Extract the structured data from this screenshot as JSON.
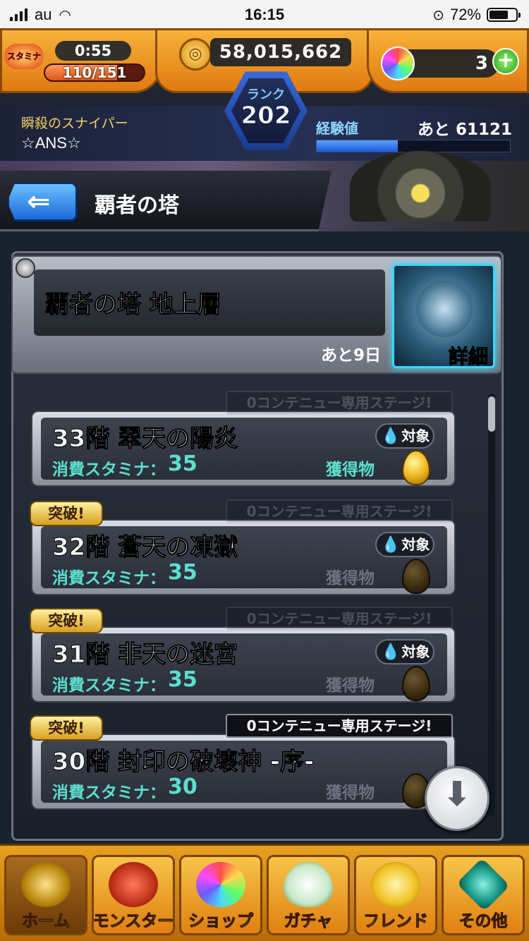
{
  "status_bar": {
    "carrier": "au",
    "time": "16:15",
    "battery": "72%",
    "battery_level": 0.72
  },
  "hud": {
    "stamina_label": "スタミナ",
    "stamina_timer": "0:55",
    "stamina": "110/151",
    "stamina_level": 0.73,
    "gold": "58,015,662",
    "orbs": "3",
    "add_label": "+",
    "rank_label": "ランク",
    "rank": "202",
    "exp_label": "経験値",
    "exp_remaining": "あと 61121",
    "exp_level": 0.42
  },
  "player": {
    "title": "瞬殺のスナイパー",
    "name": "☆ANS☆"
  },
  "header": {
    "back_arrow": "⇐",
    "title": "覇者の塔"
  },
  "dungeon": {
    "name": "覇者の塔 地上層",
    "days_left": "あと9日",
    "detail_label": "詳細"
  },
  "stage_common": {
    "stamina_label": "消費スタミナ：",
    "reward_label": "獲得物",
    "target_label": "対象",
    "breakthrough_label": "突破!",
    "notice_label": "0コンテニュー専用ステージ!"
  },
  "stages": [
    {
      "floor": "33階 翠天の陽炎",
      "stamina": "35",
      "cleared": false,
      "target": true,
      "notice_visible": false,
      "egg": "gold"
    },
    {
      "floor": "32階 蒼天の凍獄",
      "stamina": "35",
      "cleared": true,
      "target": true,
      "notice_visible": false,
      "egg": "dark"
    },
    {
      "floor": "31階 非天の迷宮",
      "stamina": "35",
      "cleared": true,
      "target": true,
      "notice_visible": false,
      "egg": "dark"
    },
    {
      "floor": "30階 封印の破壊神 -序-",
      "stamina": "30",
      "cleared": true,
      "target": false,
      "notice_visible": true,
      "egg": "dark"
    }
  ],
  "download_icon": "download-arrow-icon",
  "bottom_nav": [
    {
      "label": "ホーム",
      "icon": "home-icon",
      "active": true
    },
    {
      "label": "モンスター",
      "icon": "monster-icon",
      "active": false
    },
    {
      "label": "ショップ",
      "icon": "orb-icon",
      "active": false
    },
    {
      "label": "ガチャ",
      "icon": "egg-icon",
      "active": false
    },
    {
      "label": "フレンド",
      "icon": "friend-icon",
      "active": false
    },
    {
      "label": "その他",
      "icon": "other-icon",
      "active": false
    }
  ]
}
